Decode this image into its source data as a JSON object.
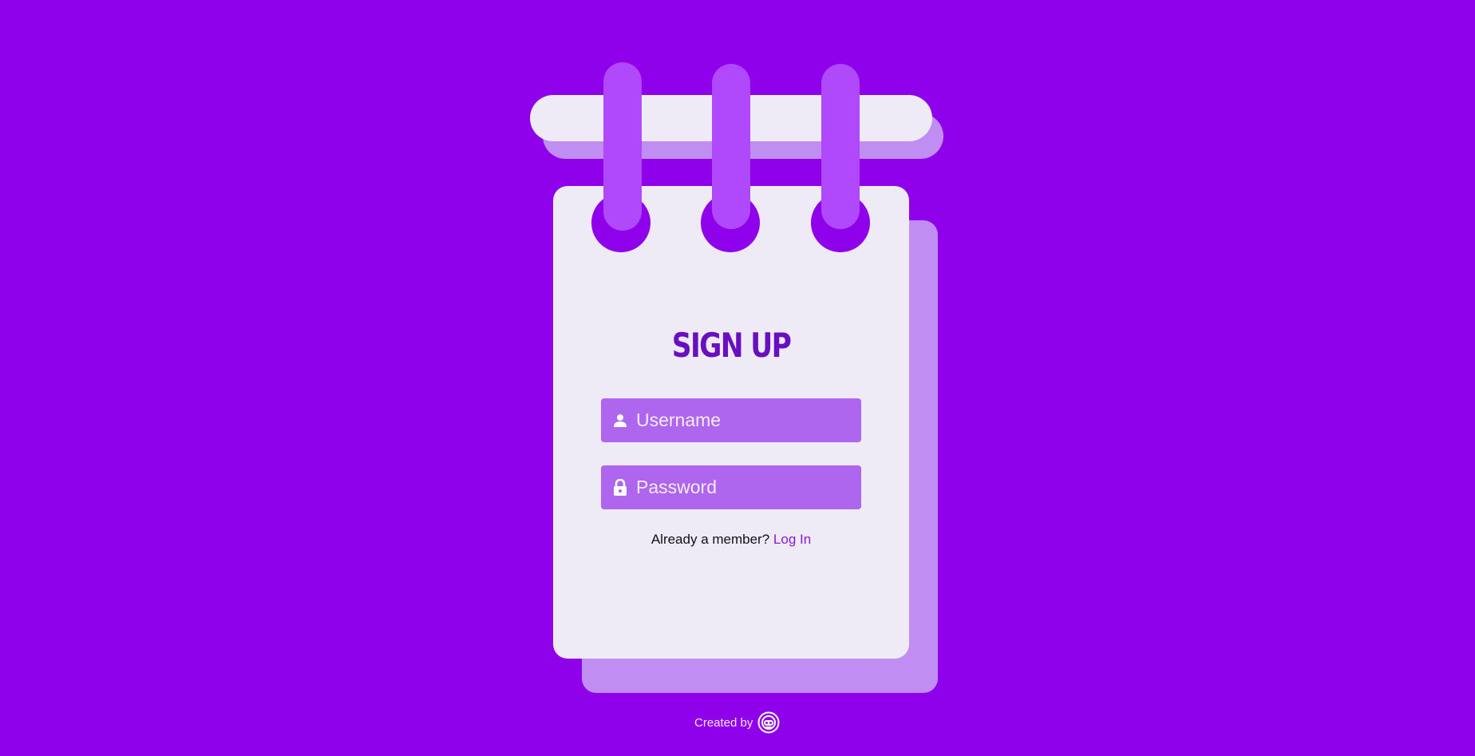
{
  "page": {
    "background": "#8f00eb"
  },
  "signup": {
    "title": "SIGN UP",
    "username": {
      "placeholder": "Username",
      "icon": "user-icon"
    },
    "password": {
      "placeholder": "Password",
      "icon": "lock-icon"
    },
    "member_prompt": "Already a member?",
    "login_link": "Log In"
  },
  "footer": {
    "credit_text": "Created by",
    "logo_icon": "creator-logo-icon"
  },
  "colors": {
    "accent": "#6a0fc0",
    "field": "#af66ee",
    "paper": "#eeebf7",
    "ring": "#b048fb",
    "link": "#8a19d6"
  }
}
